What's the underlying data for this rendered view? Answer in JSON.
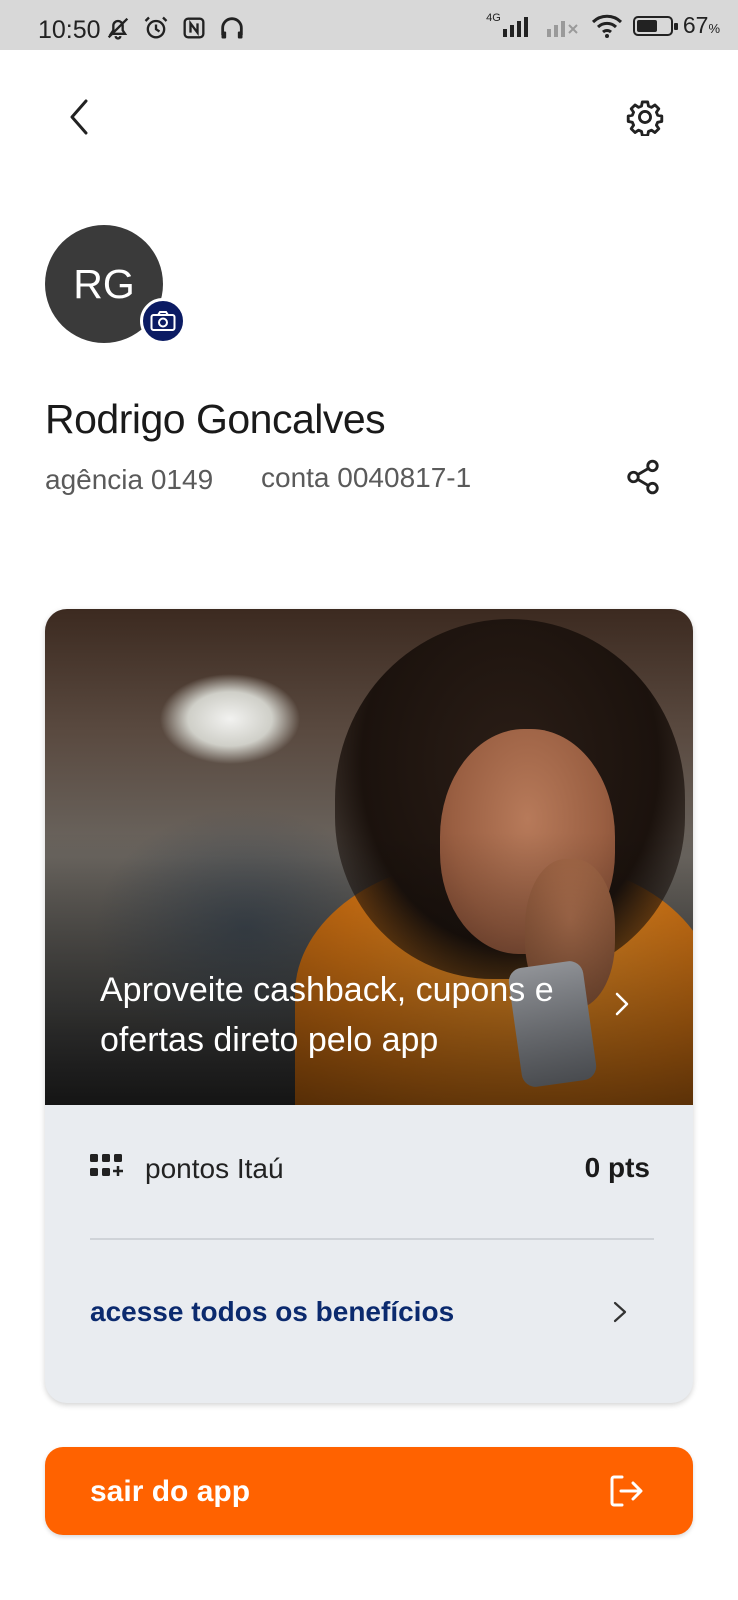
{
  "status_bar": {
    "time": "10:50",
    "network_label": "4G",
    "battery_level": 0.67,
    "battery_text": "67",
    "battery_unit": "%",
    "icons": [
      "mute-bell-icon",
      "alarm-icon",
      "nfc-icon",
      "headphones-icon",
      "signal-icon",
      "wifi-icon",
      "battery-icon"
    ]
  },
  "nav": {
    "back_icon": "chevron-left-icon",
    "settings_icon": "gear-icon"
  },
  "profile": {
    "initials": "RG",
    "name": "Rodrigo Goncalves",
    "agency": "agência 0149",
    "account": "conta 0040817-1",
    "avatar_bg": "#3a3a3a",
    "camera_badge_bg": "#0b1b63"
  },
  "card": {
    "banner_text": "Aproveite cashback, cupons e ofertas direto pelo app",
    "points_label": "pontos Itaú",
    "points_value": "0 pts",
    "benefits_label": "acesse todos os benefícios",
    "benefits_color": "#0b2a6e"
  },
  "exit_button": {
    "label": "sair do app",
    "color": "#ff6200"
  }
}
